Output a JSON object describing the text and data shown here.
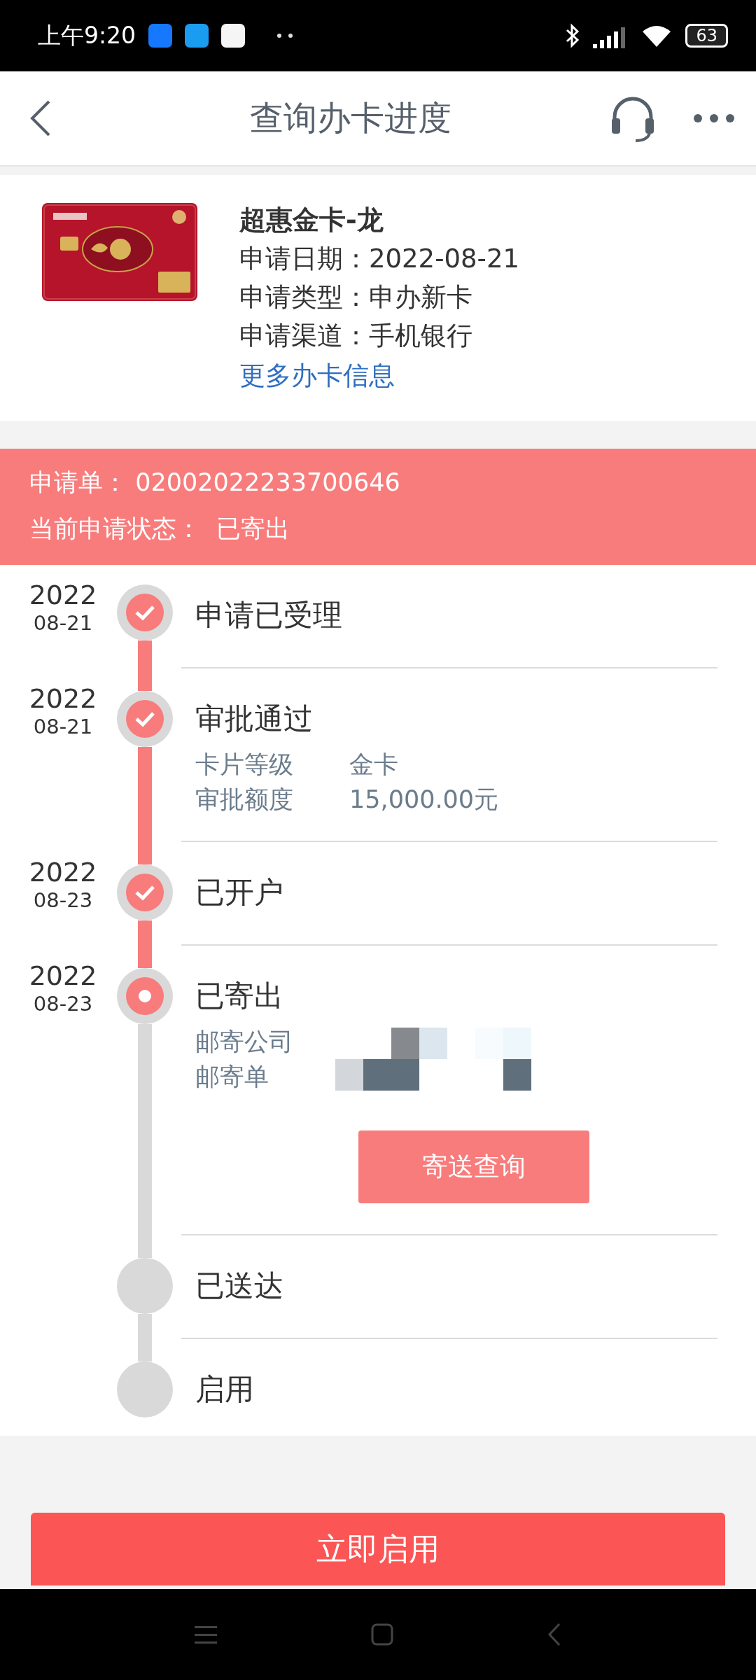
{
  "status_bar": {
    "time": "上午9:20",
    "battery": "63"
  },
  "header": {
    "title": "查询办卡进度"
  },
  "card": {
    "name": "超惠金卡-龙",
    "fields": [
      {
        "label": "申请日期：",
        "value": "2022-08-21"
      },
      {
        "label": "申请类型：",
        "value": "申办新卡"
      },
      {
        "label": "申请渠道：",
        "value": "手机银行"
      }
    ],
    "link": "更多办卡信息"
  },
  "application": {
    "number_label": "申请单：",
    "number": "02002022233700646",
    "status_label": "当前申请状态：",
    "status": "已寄出"
  },
  "steps": [
    {
      "year": "2022",
      "date": "08-21",
      "title": "申请已受理",
      "kind": "done"
    },
    {
      "year": "2022",
      "date": "08-21",
      "title": "审批通过",
      "kind": "done",
      "details": [
        {
          "label": "卡片等级",
          "value": "金卡"
        },
        {
          "label": "审批额度",
          "value": "15,000.00元"
        }
      ]
    },
    {
      "year": "2022",
      "date": "08-23",
      "title": "已开户",
      "kind": "done"
    },
    {
      "year": "2022",
      "date": "08-23",
      "title": "已寄出",
      "kind": "current",
      "details": [
        {
          "label": "邮寄公司"
        },
        {
          "label": "邮寄单"
        }
      ],
      "action": "寄送查询"
    },
    {
      "title": "已送达",
      "kind": "pending"
    },
    {
      "title": "启用",
      "kind": "pending"
    }
  ],
  "footer": {
    "button": "立即启用"
  }
}
